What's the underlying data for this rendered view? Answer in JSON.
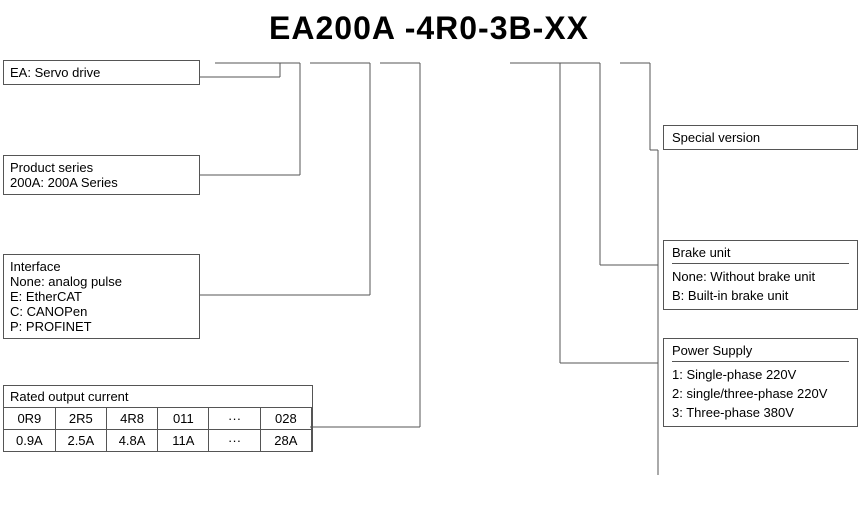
{
  "title": "EA200A -4R0-3B-XX",
  "left": {
    "servo_box": {
      "label": "EA: Servo drive"
    },
    "product_box": {
      "title": "Product series",
      "description": "200A: 200A Series"
    },
    "interface_box": {
      "title": "Interface",
      "items": [
        "None: analog pulse",
        "E: EtherCAT",
        "C: CANOPen",
        "P: PROFINET"
      ]
    },
    "rated_box": {
      "title": "Rated output current",
      "codes": [
        "0R9",
        "2R5",
        "4R8",
        "011",
        "···",
        "028"
      ],
      "values": [
        "0.9A",
        "2.5A",
        "4.8A",
        "11A",
        "···",
        "28A"
      ]
    }
  },
  "right": {
    "special_box": {
      "title": "Special version"
    },
    "brake_box": {
      "title": "Brake unit",
      "items": [
        "None: Without brake unit",
        "B: Built-in brake unit"
      ]
    },
    "power_box": {
      "title": "Power Supply",
      "items": [
        "1: Single-phase 220V",
        "2: single/three-phase 220V",
        "3: Three-phase 380V"
      ]
    }
  }
}
